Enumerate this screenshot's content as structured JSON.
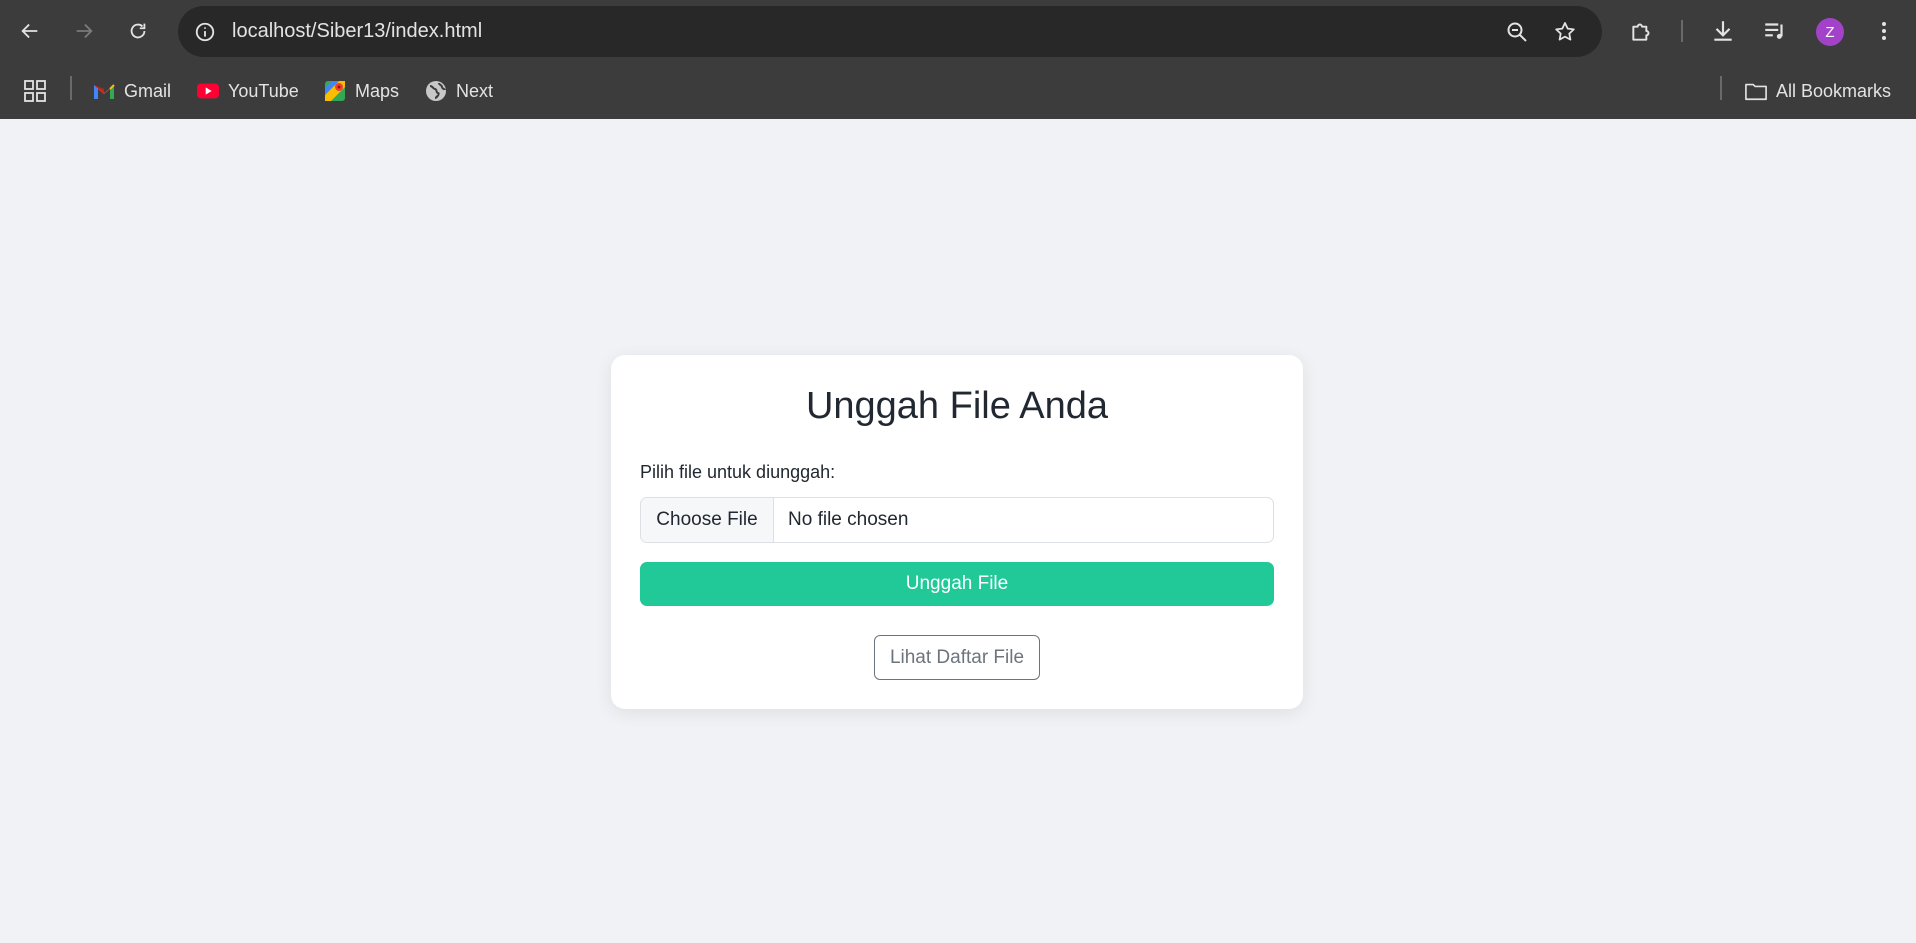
{
  "browser": {
    "url": "localhost/Siber13/index.html",
    "avatar_initial": "Z",
    "avatar_color": "#a142c9",
    "bookmarks": [
      {
        "label": "Gmail",
        "icon": "gmail-icon"
      },
      {
        "label": "YouTube",
        "icon": "youtube-icon"
      },
      {
        "label": "Maps",
        "icon": "maps-icon"
      },
      {
        "label": "Next",
        "icon": "globe-icon"
      }
    ],
    "all_bookmarks_label": "All Bookmarks"
  },
  "upload_card": {
    "title": "Unggah File Anda",
    "field_label": "Pilih file untuk diunggah:",
    "choose_file_label": "Choose File",
    "file_status": "No file chosen",
    "upload_button_label": "Unggah File",
    "list_button_label": "Lihat Daftar File",
    "accent_color": "#20c997"
  }
}
